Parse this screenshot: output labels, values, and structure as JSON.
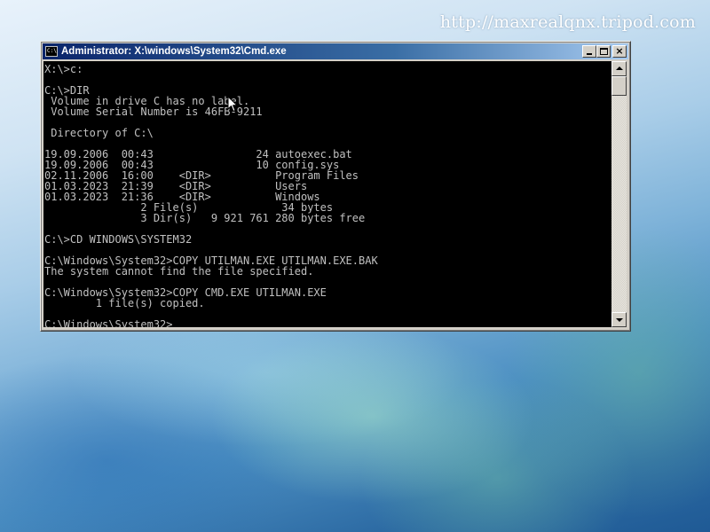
{
  "watermark": {
    "text": "http://maxrealqnx.tripod.com"
  },
  "window": {
    "title": "Administrator: X:\\windows\\System32\\Cmd.exe",
    "icon": "cmd-icon",
    "icon_text": "C:\\",
    "buttons": {
      "minimize": "minimize-icon",
      "maximize": "maximize-icon",
      "close": "×"
    }
  },
  "console": {
    "text": "X:\\>c:\n\nC:\\>DIR\n Volume in drive C has no label.\n Volume Serial Number is 46FB-9211\n\n Directory of C:\\\n\n19.09.2006  00:43                24 autoexec.bat\n19.09.2006  00:43                10 config.sys\n02.11.2006  16:00    <DIR>          Program Files\n01.03.2023  21:39    <DIR>          Users\n01.03.2023  21:36    <DIR>          Windows\n               2 File(s)             34 bytes\n               3 Dir(s)   9 921 761 280 bytes free\n\nC:\\>CD WINDOWS\\SYSTEM32\n\nC:\\Windows\\System32>COPY UTILMAN.EXE UTILMAN.EXE.BAK\nThe system cannot find the file specified.\n\nC:\\Windows\\System32>COPY CMD.EXE UTILMAN.EXE\n        1 file(s) copied.\n\nC:\\Windows\\System32>"
  },
  "colors": {
    "title_bar_start": "#0a246a",
    "title_bar_end": "#a6caf0",
    "console_background": "#000000",
    "console_text": "#c0c0c0",
    "window_chrome": "#d4d0c8"
  },
  "icons": {
    "scroll_up": "arrow-up-icon",
    "scroll_down": "arrow-down-icon",
    "mouse_cursor": "mouse-pointer-icon"
  }
}
